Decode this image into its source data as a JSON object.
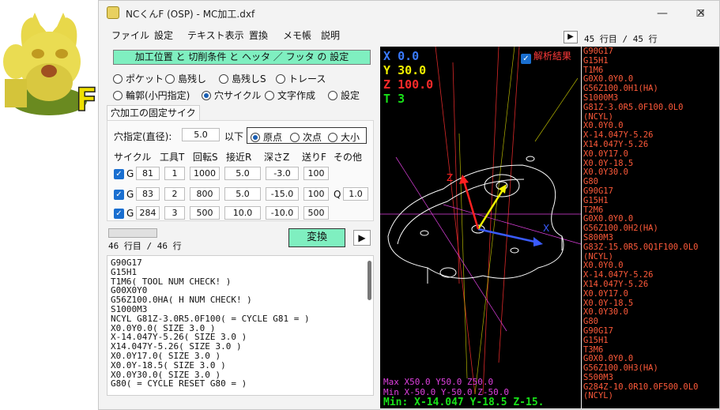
{
  "window": {
    "title": "NCくんF (OSP) - MC加工.dxf",
    "minimize": "—",
    "maximize": "☐",
    "close": "✕"
  },
  "menu": [
    "ファイル",
    "設定",
    "テキスト表示",
    "置換",
    "メモ帳",
    "説明"
  ],
  "settings_bar": "加工位置 と 切削条件 と ヘッタ ／ フッタ の 設定",
  "modes_row1": [
    "ポケット",
    "島残し",
    "島残しS",
    "トレース"
  ],
  "modes_row2": [
    "輪郭(小円指定)",
    "穴サイクル",
    "文字作成",
    "設定"
  ],
  "selected_mode": "穴サイクル",
  "tab_label": "穴加工の固定サイクル",
  "hole": {
    "label": "穴指定(直径):",
    "value": "5.0",
    "suffix": "以下",
    "order_options": [
      "原点",
      "次点",
      "大小"
    ],
    "order_selected": "原点"
  },
  "columns": [
    "サイクル",
    "工具T",
    "回転S",
    "接近R",
    "深さZ",
    "送りF",
    "その他"
  ],
  "cycles": [
    {
      "g": "G",
      "cycle": "81",
      "tool": "1",
      "speed": "1000",
      "approach": "5.0",
      "depth": "-3.0",
      "feed": "100",
      "q_label": "",
      "q": ""
    },
    {
      "g": "G",
      "cycle": "83",
      "tool": "2",
      "speed": "800",
      "approach": "5.0",
      "depth": "-15.0",
      "feed": "100",
      "q_label": "Q",
      "q": "1.0"
    },
    {
      "g": "G",
      "cycle": "284",
      "tool": "3",
      "speed": "500",
      "approach": "10.0",
      "depth": "-10.0",
      "feed": "500",
      "q_label": "",
      "q": ""
    }
  ],
  "left_status": "46 行目 / 46 行",
  "convert_label": "変換",
  "play_label": "▶",
  "left_code": [
    "G90G17",
    "G15H1",
    "T1M6( TOOL NUM CHECK! )",
    "G00X0Y0",
    "G56Z100.0HA( H NUM CHECK! )",
    "S1000M3",
    "NCYL G81Z-3.0R5.0F100( = CYCLE G81 = )",
    "X0.0Y0.0( SIZE 3.0 )",
    "X-14.047Y-5.26( SIZE 3.0 )",
    "X14.047Y-5.26( SIZE 3.0 )",
    "X0.0Y17.0( SIZE 3.0 )",
    "X0.0Y-18.5( SIZE 3.0 )",
    "X0.0Y30.0( SIZE 3.0 )",
    "G80( = CYCLE RESET G80 = )"
  ],
  "viewer": {
    "x_label": "X",
    "x_value": "0.0",
    "y_label": "Y",
    "y_value": "30.0",
    "z_label": "Z",
    "z_value": "100.0",
    "t_label": "T",
    "t_value": "3",
    "analysis_label": "解析結果",
    "max_line": "Max X50.0 Y50.0 Z50.0",
    "min_line": "Min X-50.0 Y-50.0 Z-50.0",
    "min_status": "Min: X-14.047  Y-18.5  Z-15.",
    "colors": {
      "x": "#3a7bff",
      "y": "#f0f000",
      "z": "#ff2a2a",
      "t": "#18e018"
    }
  },
  "right_status": "45 行目 / 45 行",
  "right_code": [
    "G90G17",
    "G15H1",
    "T1M6",
    "G0X0.0Y0.0",
    "G56Z100.0H1(HA)",
    "S1000M3",
    "G81Z-3.0R5.0F100.0L0",
    "(NCYL)",
    "X0.0Y0.0",
    "X-14.047Y-5.26",
    "X14.047Y-5.26",
    "X0.0Y17.0",
    "X0.0Y-18.5",
    "X0.0Y30.0",
    "G80",
    "G90G17",
    "G15H1",
    "T2M6",
    "G0X0.0Y0.0",
    "G56Z100.0H2(HA)",
    "S800M3",
    "G83Z-15.0R5.0Q1F100.0L0",
    "(NCYL)",
    "X0.0Y0.0",
    "X-14.047Y-5.26",
    "X14.047Y-5.26",
    "X0.0Y17.0",
    "X0.0Y-18.5",
    "X0.0Y30.0",
    "G80",
    "G90G17",
    "G15H1",
    "T3M6",
    "G0X0.0Y0.0",
    "G56Z100.0H3(HA)",
    "S500M3",
    "G284Z-10.0R10.0F500.0L0",
    "(NCYL)"
  ],
  "mascot_letter": "F"
}
